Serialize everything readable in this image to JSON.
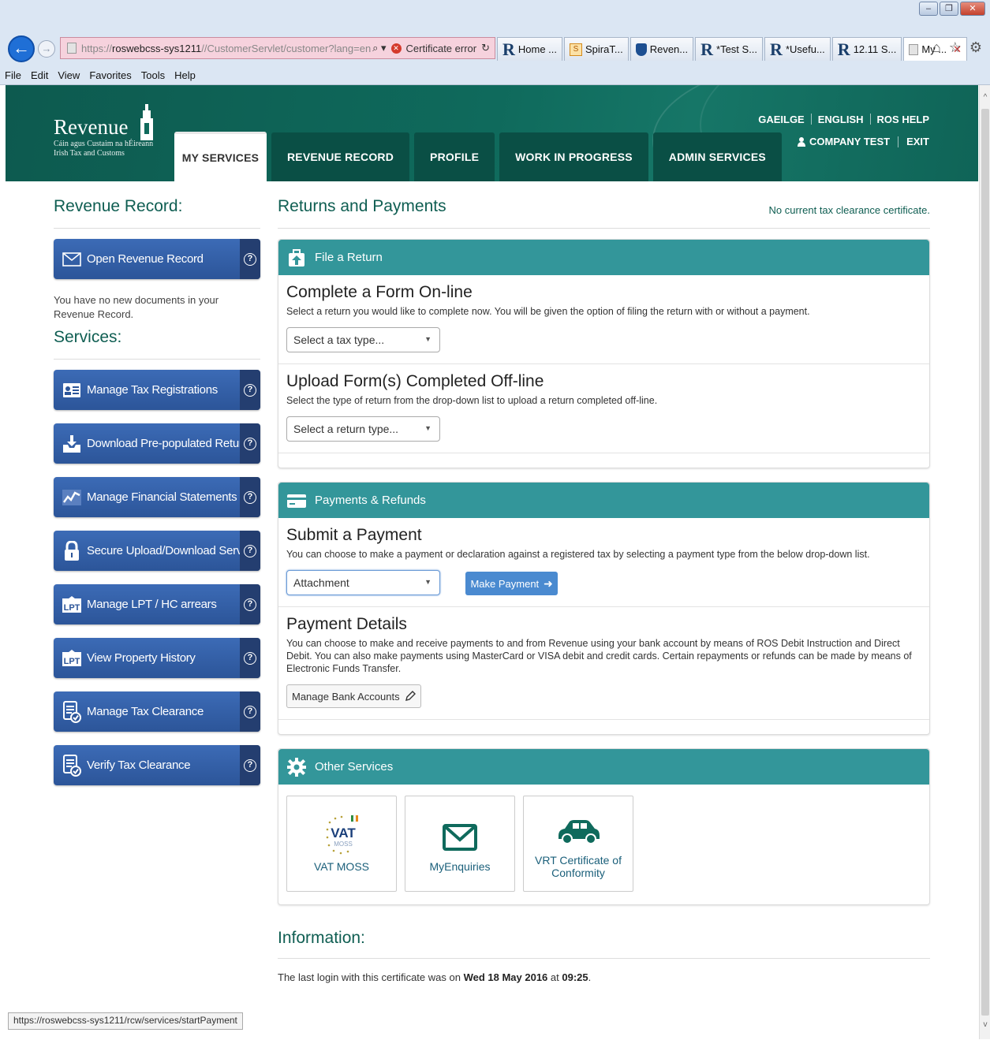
{
  "browser": {
    "address_url_gray": "https://",
    "address_url_dark": "roswebcss-sys1211",
    "address_url_rest": "//CustomerServlet/customer?lang=en",
    "search_glyph": "⌕ ▾",
    "cert_error": "Certificate error",
    "tabs": [
      {
        "label": "Home ...",
        "icon": "revenue-r"
      },
      {
        "label": "SpiraT...",
        "icon": "spira"
      },
      {
        "label": "Reven...",
        "icon": "shield"
      },
      {
        "label": "*Test S...",
        "icon": "revenue-r"
      },
      {
        "label": "*Usefu...",
        "icon": "revenue-r"
      },
      {
        "label": "12.11 S...",
        "icon": "revenue-r"
      },
      {
        "label": "My ...",
        "icon": "page",
        "active": true
      }
    ],
    "menu": [
      "File",
      "Edit",
      "View",
      "Favorites",
      "Tools",
      "Help"
    ],
    "status_url": "https://roswebcss-sys1211/rcw/services/startPayment"
  },
  "header": {
    "logo_name": "Revenue",
    "logo_sub1": "Cáin agus Custaim na hÉireann",
    "logo_sub2": "Irish Tax and Customs",
    "lang": [
      "GAEILGE",
      "ENGLISH",
      "ROS HELP"
    ],
    "user": "COMPANY TEST",
    "exit": "EXIT",
    "tabs": [
      "MY SERVICES",
      "REVENUE RECORD",
      "PROFILE",
      "WORK IN PROGRESS",
      "ADMIN SERVICES"
    ]
  },
  "left": {
    "record_title": "Revenue Record:",
    "open_record": "Open Revenue Record",
    "no_docs": "You have no new documents in your Revenue Record.",
    "services_title": "Services:",
    "services": [
      {
        "label": "Manage Tax Registrations",
        "icon": "id-card-icon"
      },
      {
        "label": "Download Pre-populated Returns",
        "icon": "download-tray-icon"
      },
      {
        "label": "Manage Financial Statements",
        "icon": "line-chart-icon"
      },
      {
        "label": "Secure Upload/Download Service",
        "icon": "padlock-icon"
      },
      {
        "label": "Manage LPT / HC arrears",
        "icon": "lpt-icon"
      },
      {
        "label": "View Property History",
        "icon": "lpt-icon"
      },
      {
        "label": "Manage Tax Clearance",
        "icon": "document-check-icon"
      },
      {
        "label": "Verify Tax Clearance",
        "icon": "document-check-icon"
      }
    ]
  },
  "main": {
    "title": "Returns and Payments",
    "tcc": "No current tax clearance certificate.",
    "file_return": {
      "head": "File a Return",
      "complete_title": "Complete a Form On-line",
      "complete_desc": "Select a return you would like to complete now. You will be given the option of filing the return with or without a payment.",
      "complete_select": "Select a tax type...",
      "upload_title": "Upload Form(s) Completed Off-line",
      "upload_desc": "Select the type of return from the drop-down list to upload a return completed off-line.",
      "upload_select": "Select a return type..."
    },
    "payments": {
      "head": "Payments & Refunds",
      "submit_title": "Submit a Payment",
      "submit_desc": "You can choose to make a payment or declaration against a registered tax by selecting a payment type from the below drop-down list.",
      "submit_select": "Attachment",
      "make_payment": "Make Payment",
      "details_title": "Payment Details",
      "details_desc": "You can choose to make and receive payments to and from Revenue using your bank account by means of ROS Debit Instruction and Direct Debit. You can also make payments using MasterCard or VISA debit and credit cards. Certain repayments or refunds can be made by means of Electronic Funds Transfer.",
      "bank_btn": "Manage Bank Accounts"
    },
    "other": {
      "head": "Other Services",
      "items": [
        {
          "label": "VAT MOSS",
          "icon": "vat-moss-logo",
          "logo_text": "VAT",
          "logo_sub": "MOSS"
        },
        {
          "label": "MyEnquiries",
          "icon": "envelope-icon"
        },
        {
          "label": "VRT Certificate of Conformity",
          "icon": "car-icon"
        }
      ]
    },
    "info": {
      "title": "Information:",
      "pre": "The last login with this certificate was on ",
      "date": "Wed 18 May 2016",
      "mid": " at ",
      "time": "09:25",
      "post": "."
    }
  },
  "colors": {
    "header_green": "#0f6a5c",
    "teal_panel": "#33969a",
    "side_blue": "#2c5599",
    "heading_green": "#0f5e52"
  }
}
